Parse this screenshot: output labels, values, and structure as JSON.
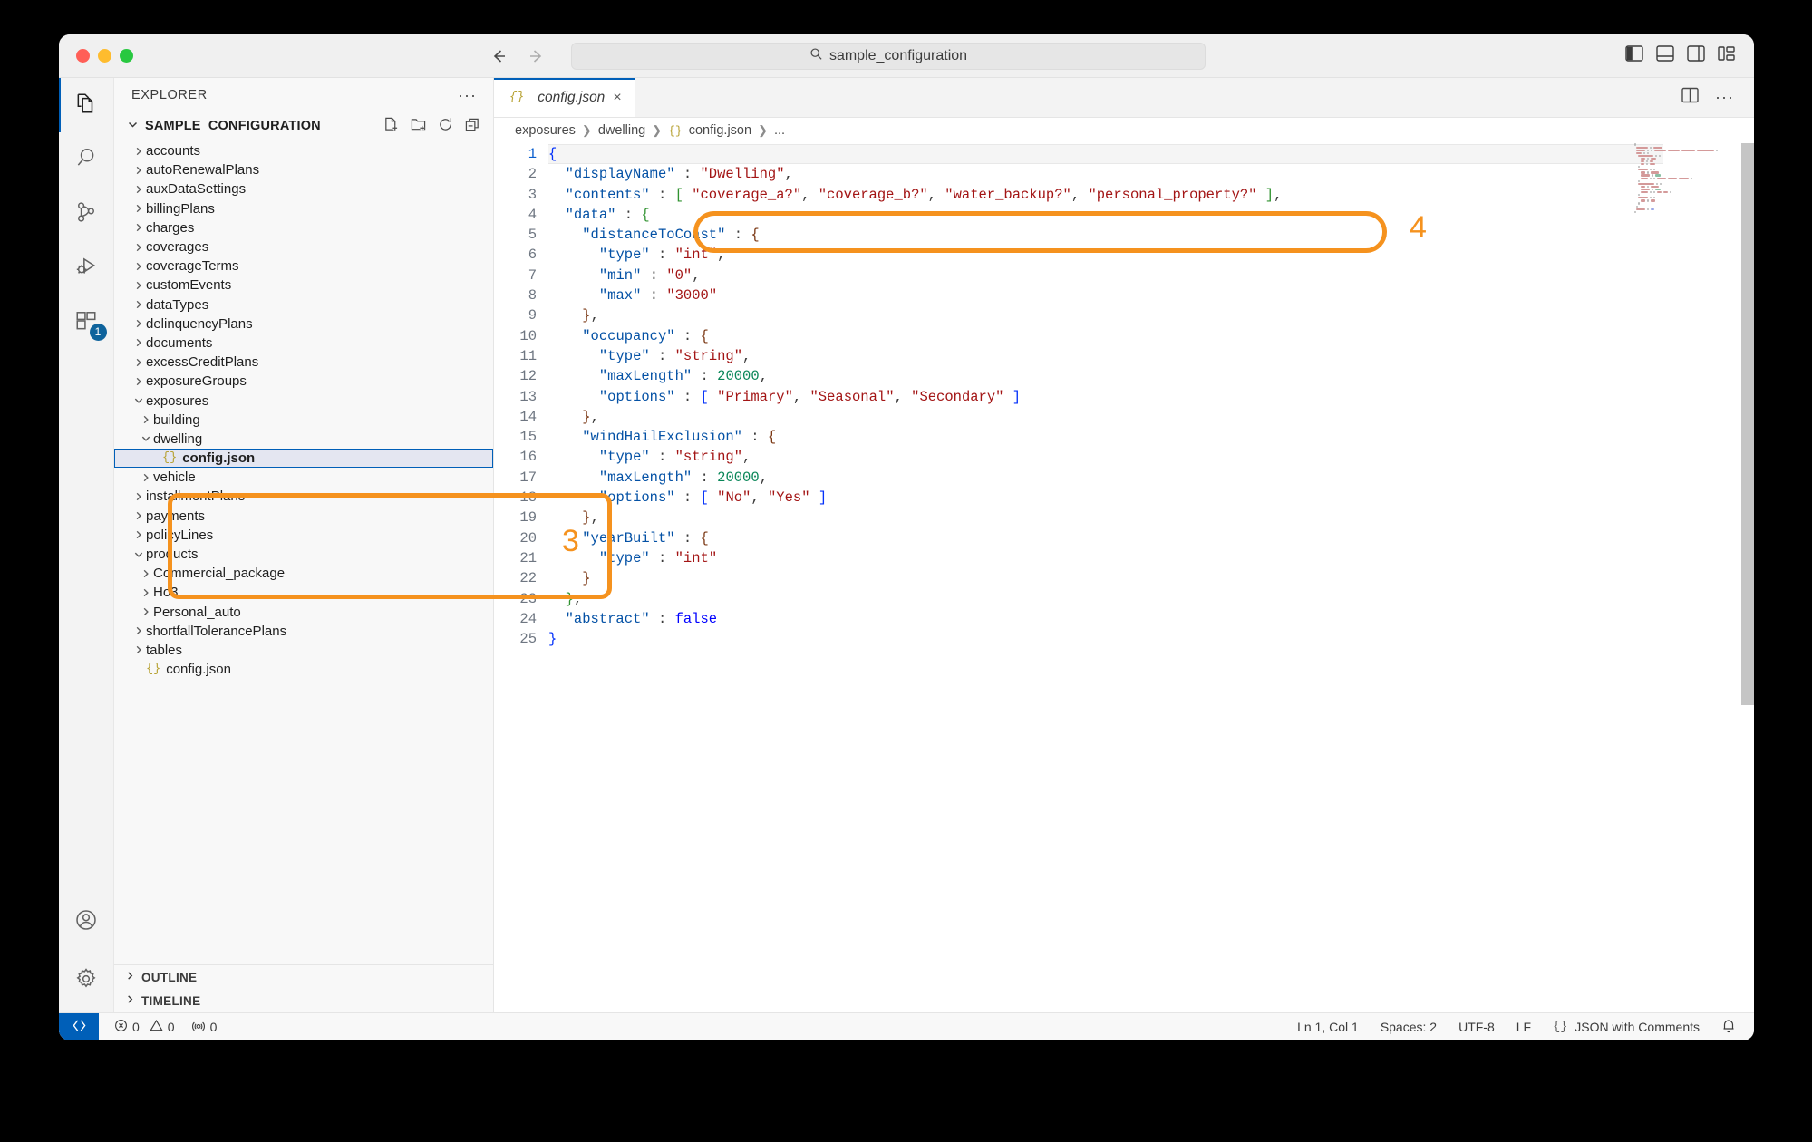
{
  "window": {
    "omnibox_text": "sample_configuration",
    "omnibox_icon": "search-icon"
  },
  "activity_bar": {
    "items": [
      {
        "name": "explorer",
        "icon": "files-icon",
        "active": true,
        "badge": ""
      },
      {
        "name": "search",
        "icon": "search-icon",
        "active": false,
        "badge": ""
      },
      {
        "name": "source-control",
        "icon": "source-control-icon",
        "active": false,
        "badge": ""
      },
      {
        "name": "run-debug",
        "icon": "run-debug-icon",
        "active": false,
        "badge": ""
      },
      {
        "name": "extensions",
        "icon": "extensions-icon",
        "active": false,
        "badge": "1"
      }
    ],
    "bottom": [
      {
        "name": "accounts",
        "icon": "account-icon"
      },
      {
        "name": "manage",
        "icon": "gear-icon"
      }
    ]
  },
  "sidebar": {
    "title": "EXPLORER",
    "more_actions": "···",
    "folder_name": "SAMPLE_CONFIGURATION",
    "folder_actions": [
      "new-file-icon",
      "new-folder-icon",
      "refresh-icon",
      "collapse-all-icon"
    ],
    "tree": [
      {
        "label": "accounts",
        "depth": 1,
        "type": "folder",
        "expanded": false
      },
      {
        "label": "autoRenewalPlans",
        "depth": 1,
        "type": "folder",
        "expanded": false
      },
      {
        "label": "auxDataSettings",
        "depth": 1,
        "type": "folder",
        "expanded": false
      },
      {
        "label": "billingPlans",
        "depth": 1,
        "type": "folder",
        "expanded": false
      },
      {
        "label": "charges",
        "depth": 1,
        "type": "folder",
        "expanded": false
      },
      {
        "label": "coverages",
        "depth": 1,
        "type": "folder",
        "expanded": false
      },
      {
        "label": "coverageTerms",
        "depth": 1,
        "type": "folder",
        "expanded": false
      },
      {
        "label": "customEvents",
        "depth": 1,
        "type": "folder",
        "expanded": false
      },
      {
        "label": "dataTypes",
        "depth": 1,
        "type": "folder",
        "expanded": false
      },
      {
        "label": "delinquencyPlans",
        "depth": 1,
        "type": "folder",
        "expanded": false
      },
      {
        "label": "documents",
        "depth": 1,
        "type": "folder",
        "expanded": false
      },
      {
        "label": "excessCreditPlans",
        "depth": 1,
        "type": "folder",
        "expanded": false
      },
      {
        "label": "exposureGroups",
        "depth": 1,
        "type": "folder",
        "expanded": false
      },
      {
        "label": "exposures",
        "depth": 1,
        "type": "folder",
        "expanded": true
      },
      {
        "label": "building",
        "depth": 2,
        "type": "folder",
        "expanded": false
      },
      {
        "label": "dwelling",
        "depth": 2,
        "type": "folder",
        "expanded": true
      },
      {
        "label": "config.json",
        "depth": 3,
        "type": "file",
        "selected": true
      },
      {
        "label": "vehicle",
        "depth": 2,
        "type": "folder",
        "expanded": false
      },
      {
        "label": "installmentPlans",
        "depth": 1,
        "type": "folder",
        "expanded": false
      },
      {
        "label": "payments",
        "depth": 1,
        "type": "folder",
        "expanded": false
      },
      {
        "label": "policyLines",
        "depth": 1,
        "type": "folder",
        "expanded": false
      },
      {
        "label": "products",
        "depth": 1,
        "type": "folder",
        "expanded": true
      },
      {
        "label": "Commercial_package",
        "depth": 2,
        "type": "folder",
        "expanded": false
      },
      {
        "label": "Ho3",
        "depth": 2,
        "type": "folder",
        "expanded": false
      },
      {
        "label": "Personal_auto",
        "depth": 2,
        "type": "folder",
        "expanded": false
      },
      {
        "label": "shortfallTolerancePlans",
        "depth": 1,
        "type": "folder",
        "expanded": false
      },
      {
        "label": "tables",
        "depth": 1,
        "type": "folder",
        "expanded": false
      },
      {
        "label": "config.json",
        "depth": 1,
        "type": "file",
        "selected": false
      }
    ],
    "sections": [
      {
        "label": "OUTLINE",
        "expanded": false
      },
      {
        "label": "TIMELINE",
        "expanded": false
      }
    ]
  },
  "editor": {
    "tab": {
      "label": "config.json",
      "icon": "json-icon",
      "close": "×"
    },
    "tab_actions": [
      "split-editor-icon",
      "more-actions-icon"
    ],
    "breadcrumb": [
      "exposures",
      "dwelling",
      "config.json",
      "..."
    ],
    "lines": [
      {
        "n": 1,
        "text": "{"
      },
      {
        "n": 2,
        "text": "  \"displayName\" : \"Dwelling\","
      },
      {
        "n": 3,
        "text": "  \"contents\" : [ \"coverage_a?\", \"coverage_b?\", \"water_backup?\", \"personal_property?\" ],"
      },
      {
        "n": 4,
        "text": "  \"data\" : {"
      },
      {
        "n": 5,
        "text": "    \"distanceToCoast\" : {"
      },
      {
        "n": 6,
        "text": "      \"type\" : \"int\","
      },
      {
        "n": 7,
        "text": "      \"min\" : \"0\","
      },
      {
        "n": 8,
        "text": "      \"max\" : \"3000\""
      },
      {
        "n": 9,
        "text": "    },"
      },
      {
        "n": 10,
        "text": "    \"occupancy\" : {"
      },
      {
        "n": 11,
        "text": "      \"type\" : \"string\","
      },
      {
        "n": 12,
        "text": "      \"maxLength\" : 20000,"
      },
      {
        "n": 13,
        "text": "      \"options\" : [ \"Primary\", \"Seasonal\", \"Secondary\" ]"
      },
      {
        "n": 14,
        "text": "    },"
      },
      {
        "n": 15,
        "text": "    \"windHailExclusion\" : {"
      },
      {
        "n": 16,
        "text": "      \"type\" : \"string\","
      },
      {
        "n": 17,
        "text": "      \"maxLength\" : 20000,"
      },
      {
        "n": 18,
        "text": "      \"options\" : [ \"No\", \"Yes\" ]"
      },
      {
        "n": 19,
        "text": "    },"
      },
      {
        "n": 20,
        "text": "    \"yearBuilt\" : {"
      },
      {
        "n": 21,
        "text": "      \"type\" : \"int\""
      },
      {
        "n": 22,
        "text": "    }"
      },
      {
        "n": 23,
        "text": "  },"
      },
      {
        "n": 24,
        "text": "  \"abstract\" : false"
      },
      {
        "n": 25,
        "text": "}"
      }
    ]
  },
  "status_bar": {
    "remote_icon": "remote-window-icon",
    "errors": "0",
    "warnings": "0",
    "ports": "0",
    "cursor": "Ln 1, Col 1",
    "indentation": "Spaces: 2",
    "encoding": "UTF-8",
    "eol": "LF",
    "language": "JSON with Comments",
    "bell": "notifications-icon"
  },
  "annotations": [
    {
      "number": "3",
      "target": "sidebar-exposures-dwelling-config"
    },
    {
      "number": "4",
      "target": "code-line-3-contents"
    }
  ],
  "colors": {
    "accent": "#005fb8",
    "annotation": "#f5921e",
    "selection": "#e4e6f1",
    "string": "#a31515",
    "key": "#0451a5",
    "number": "#098658",
    "boolean": "#0000ff"
  }
}
